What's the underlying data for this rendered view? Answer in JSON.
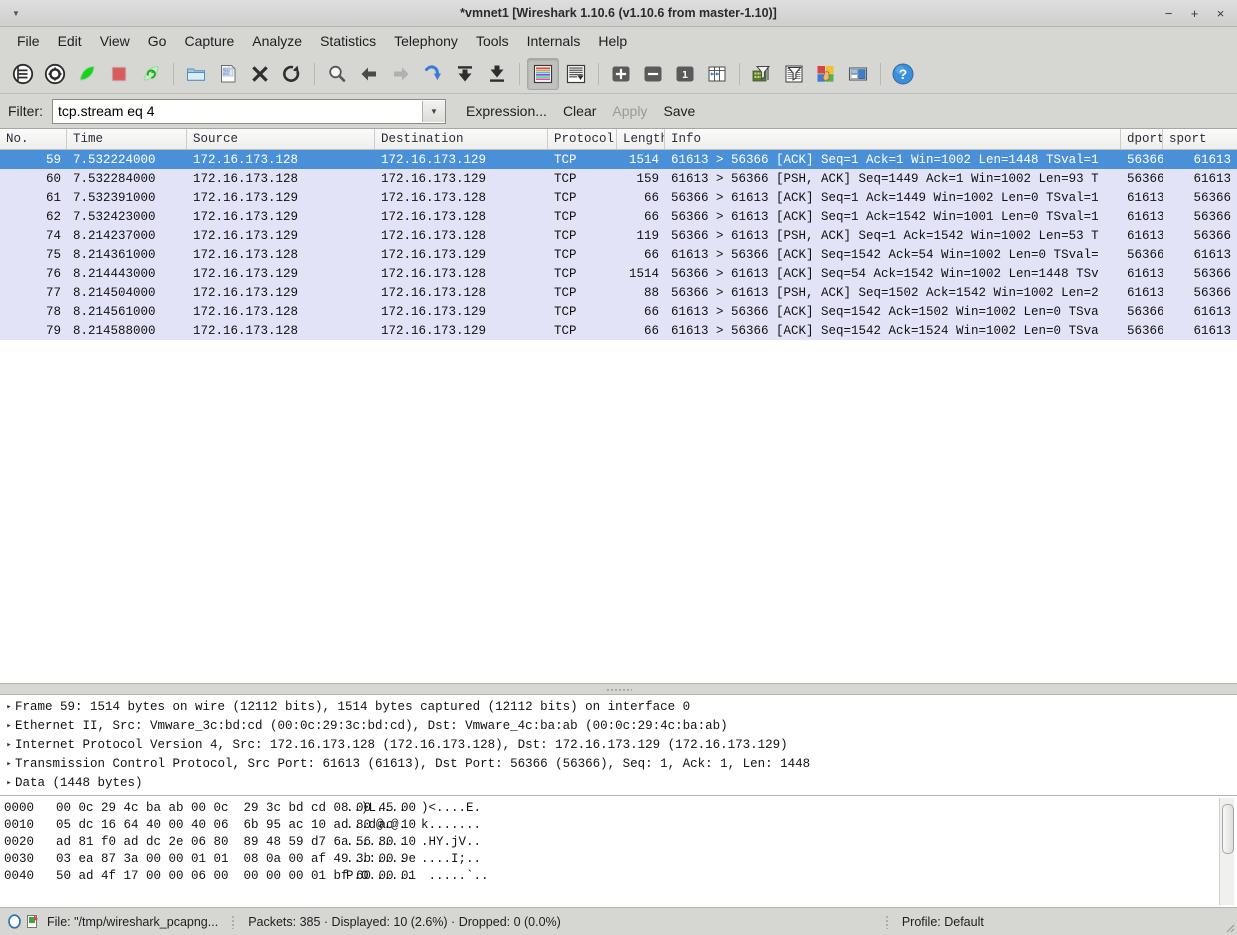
{
  "window": {
    "title": "*vmnet1  [Wireshark 1.10.6  (v1.10.6 from master-1.10)]",
    "minimize_label": "−",
    "maximize_label": "+",
    "close_label": "×",
    "menu_arrow_label": "▼"
  },
  "menubar": {
    "items": [
      {
        "label": "File"
      },
      {
        "label": "Edit"
      },
      {
        "label": "View"
      },
      {
        "label": "Go"
      },
      {
        "label": "Capture"
      },
      {
        "label": "Analyze"
      },
      {
        "label": "Statistics"
      },
      {
        "label": "Telephony"
      },
      {
        "label": "Tools"
      },
      {
        "label": "Internals"
      },
      {
        "label": "Help"
      }
    ]
  },
  "toolbar": {
    "items": [
      {
        "name": "interface-list-icon",
        "tip": "Interface List"
      },
      {
        "name": "capture-options-icon",
        "tip": "Capture Options"
      },
      {
        "name": "start-capture-icon",
        "tip": "Start Capture"
      },
      {
        "name": "stop-capture-icon",
        "tip": "Stop Capture"
      },
      {
        "name": "restart-capture-icon",
        "tip": "Restart Capture"
      },
      {
        "name": "open-file-icon",
        "tip": "Open"
      },
      {
        "name": "save-file-icon",
        "tip": "Save As"
      },
      {
        "name": "close-file-icon",
        "tip": "Close"
      },
      {
        "name": "reload-icon",
        "tip": "Reload"
      },
      {
        "name": "find-packet-icon",
        "tip": "Find Packet"
      },
      {
        "name": "go-back-icon",
        "tip": "Go Back"
      },
      {
        "name": "go-forward-icon",
        "tip": "Go Forward"
      },
      {
        "name": "go-to-packet-icon",
        "tip": "Go To Packet"
      },
      {
        "name": "go-to-first-icon",
        "tip": "Go To First Packet"
      },
      {
        "name": "go-to-last-icon",
        "tip": "Go To Last Packet"
      },
      {
        "name": "colorize-icon",
        "tip": "Colorize"
      },
      {
        "name": "auto-scroll-icon",
        "tip": "Auto Scroll in Live Capture"
      },
      {
        "name": "zoom-in-icon",
        "tip": "Zoom In"
      },
      {
        "name": "zoom-out-icon",
        "tip": "Zoom Out"
      },
      {
        "name": "zoom-reset-icon",
        "tip": "Normal Size"
      },
      {
        "name": "resize-columns-icon",
        "tip": "Resize Columns"
      },
      {
        "name": "capture-filters-icon",
        "tip": "Capture Filters"
      },
      {
        "name": "display-filters-icon",
        "tip": "Display Filters"
      },
      {
        "name": "coloring-rules-icon",
        "tip": "Coloring Rules"
      },
      {
        "name": "preferences-icon",
        "tip": "Preferences"
      },
      {
        "name": "help-icon",
        "tip": "Help"
      }
    ]
  },
  "filterbar": {
    "label": "Filter:",
    "value": "tcp.stream eq 4",
    "placeholder": "",
    "dropdown_glyph": "▼",
    "expression_label": "Expression...",
    "clear_label": "Clear",
    "apply_label": "Apply",
    "save_label": "Save"
  },
  "packet_list": {
    "columns": [
      {
        "key": "no",
        "label": "No."
      },
      {
        "key": "time",
        "label": "Time"
      },
      {
        "key": "source",
        "label": "Source"
      },
      {
        "key": "destination",
        "label": "Destination"
      },
      {
        "key": "protocol",
        "label": "Protocol"
      },
      {
        "key": "length",
        "label": "Length"
      },
      {
        "key": "info",
        "label": "Info"
      },
      {
        "key": "dport",
        "label": "dport"
      },
      {
        "key": "sport",
        "label": "sport"
      }
    ],
    "rows": [
      {
        "no": "59",
        "time": "7.532224000",
        "source": "172.16.173.128",
        "destination": "172.16.173.129",
        "protocol": "TCP",
        "length": "1514",
        "info": "61613 > 56366 [ACK] Seq=1 Ack=1 Win=1002 Len=1448 TSval=1",
        "dport": "56366",
        "sport": "61613",
        "selected": true
      },
      {
        "no": "60",
        "time": "7.532284000",
        "source": "172.16.173.128",
        "destination": "172.16.173.129",
        "protocol": "TCP",
        "length": "159",
        "info": "61613 > 56366 [PSH, ACK] Seq=1449 Ack=1 Win=1002 Len=93 T",
        "dport": "56366",
        "sport": "61613",
        "selected": false
      },
      {
        "no": "61",
        "time": "7.532391000",
        "source": "172.16.173.129",
        "destination": "172.16.173.128",
        "protocol": "TCP",
        "length": "66",
        "info": "56366 > 61613 [ACK] Seq=1 Ack=1449 Win=1002 Len=0 TSval=1",
        "dport": "61613",
        "sport": "56366",
        "selected": false
      },
      {
        "no": "62",
        "time": "7.532423000",
        "source": "172.16.173.129",
        "destination": "172.16.173.128",
        "protocol": "TCP",
        "length": "66",
        "info": "56366 > 61613 [ACK] Seq=1 Ack=1542 Win=1001 Len=0 TSval=1",
        "dport": "61613",
        "sport": "56366",
        "selected": false
      },
      {
        "no": "74",
        "time": "8.214237000",
        "source": "172.16.173.129",
        "destination": "172.16.173.128",
        "protocol": "TCP",
        "length": "119",
        "info": "56366 > 61613 [PSH, ACK] Seq=1 Ack=1542 Win=1002 Len=53 T",
        "dport": "61613",
        "sport": "56366",
        "selected": false
      },
      {
        "no": "75",
        "time": "8.214361000",
        "source": "172.16.173.128",
        "destination": "172.16.173.129",
        "protocol": "TCP",
        "length": "66",
        "info": "61613 > 56366 [ACK] Seq=1542 Ack=54 Win=1002 Len=0 TSval=",
        "dport": "56366",
        "sport": "61613",
        "selected": false
      },
      {
        "no": "76",
        "time": "8.214443000",
        "source": "172.16.173.129",
        "destination": "172.16.173.128",
        "protocol": "TCP",
        "length": "1514",
        "info": "56366 > 61613 [ACK] Seq=54 Ack=1542 Win=1002 Len=1448 TSv",
        "dport": "61613",
        "sport": "56366",
        "selected": false
      },
      {
        "no": "77",
        "time": "8.214504000",
        "source": "172.16.173.129",
        "destination": "172.16.173.128",
        "protocol": "TCP",
        "length": "88",
        "info": "56366 > 61613 [PSH, ACK] Seq=1502 Ack=1542 Win=1002 Len=2",
        "dport": "61613",
        "sport": "56366",
        "selected": false
      },
      {
        "no": "78",
        "time": "8.214561000",
        "source": "172.16.173.128",
        "destination": "172.16.173.129",
        "protocol": "TCP",
        "length": "66",
        "info": "61613 > 56366 [ACK] Seq=1542 Ack=1502 Win=1002 Len=0 TSva",
        "dport": "56366",
        "sport": "61613",
        "selected": false
      },
      {
        "no": "79",
        "time": "8.214588000",
        "source": "172.16.173.128",
        "destination": "172.16.173.129",
        "protocol": "TCP",
        "length": "66",
        "info": "61613 > 56366 [ACK] Seq=1542 Ack=1524 Win=1002 Len=0 TSva",
        "dport": "56366",
        "sport": "61613",
        "selected": false
      }
    ]
  },
  "packet_details": {
    "triangle_glyph": "▸",
    "rows": [
      {
        "text": "Frame 59: 1514 bytes on wire (12112 bits), 1514 bytes captured (12112 bits) on interface 0"
      },
      {
        "text": "Ethernet II, Src: Vmware_3c:bd:cd (00:0c:29:3c:bd:cd), Dst: Vmware_4c:ba:ab (00:0c:29:4c:ba:ab)"
      },
      {
        "text": "Internet Protocol Version 4, Src: 172.16.173.128 (172.16.173.128), Dst: 172.16.173.129 (172.16.173.129)"
      },
      {
        "text": "Transmission Control Protocol, Src Port: 61613 (61613), Dst Port: 56366 (56366), Seq: 1, Ack: 1, Len: 1448"
      },
      {
        "text": "Data (1448 bytes)"
      }
    ]
  },
  "hex_dump": {
    "rows": [
      {
        "offset": "0000",
        "hex": "00 0c 29 4c ba ab 00 0c  29 3c bd cd 08 00 45 00",
        "ascii": "..)L....  )<....E."
      },
      {
        "offset": "0010",
        "hex": "05 dc 16 64 40 00 40 06  6b 95 ac 10 ad 80 ac 10",
        "ascii": "...d@.@.  k......."
      },
      {
        "offset": "0020",
        "hex": "ad 81 f0 ad dc 2e 06 80  89 48 59 d7 6a 56 80 10",
        "ascii": "........  .HY.jV.."
      },
      {
        "offset": "0030",
        "hex": "03 ea 87 3a 00 00 01 01  08 0a 00 af 49 3b 00 9e",
        "ascii": "...:....  ....I;.."
      },
      {
        "offset": "0040",
        "hex": "50 ad 4f 17 00 00 06 00  00 00 00 01 bf 60 00 01",
        "ascii": "P.O......  .....`.."
      }
    ]
  },
  "statusbar": {
    "file_text": "File: \"/tmp/wireshark_pcapng...",
    "stats_text": "Packets: 385 · Displayed: 10 (2.6%) · Dropped: 0 (0.0%)",
    "profile_text": "Profile: Default"
  },
  "colors": {
    "selection_blue": "#4a90d9",
    "row_lavender": "#e3e3f8",
    "chrome_gray": "#d6d6d2"
  }
}
